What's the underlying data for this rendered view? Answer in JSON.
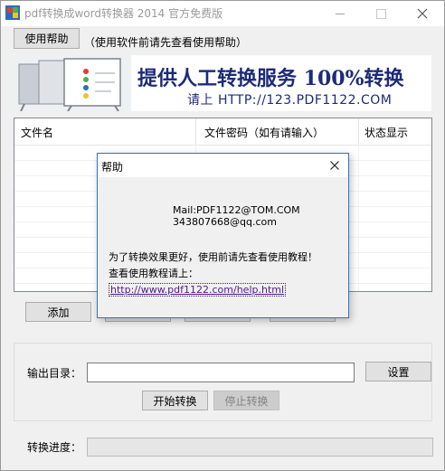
{
  "window": {
    "title": "pdf转换成word转换器 2014 官方免费版",
    "icon": "app-logo-icon"
  },
  "toolbar": {
    "help_button": "使用帮助",
    "help_note": "（使用软件前请先查看使用帮助）"
  },
  "banner": {
    "headline": "提供人工转换服务 100%转换",
    "subline": "请上  HTTP://123.PDF1122.COM"
  },
  "file_list": {
    "columns": [
      "文件名",
      "文件密码（如有请输入）",
      "状态显示"
    ],
    "rows": []
  },
  "actions": {
    "add_button": "添加"
  },
  "output": {
    "dir_label": "输出目录：",
    "dir_value": "",
    "settings_button": "设置",
    "start_button": "开始转换",
    "stop_button": "停止转换"
  },
  "progress": {
    "label": "转换进度：",
    "fraction": 0
  },
  "dialog": {
    "title": "帮助",
    "mail_line": "Mail:PDF1122@TOM.COM",
    "qq_line": "343807668@qq.com",
    "tip_line": "为了转换效果更好，使用前请先查看使用教程！",
    "tutorial_line": "查看使用教程请上：",
    "link": "http://www.pdf1122.com/help.html"
  },
  "colors": {
    "accent_border": "#2b79c2",
    "banner_text": "#1d2b78",
    "link": "#551a8b"
  }
}
